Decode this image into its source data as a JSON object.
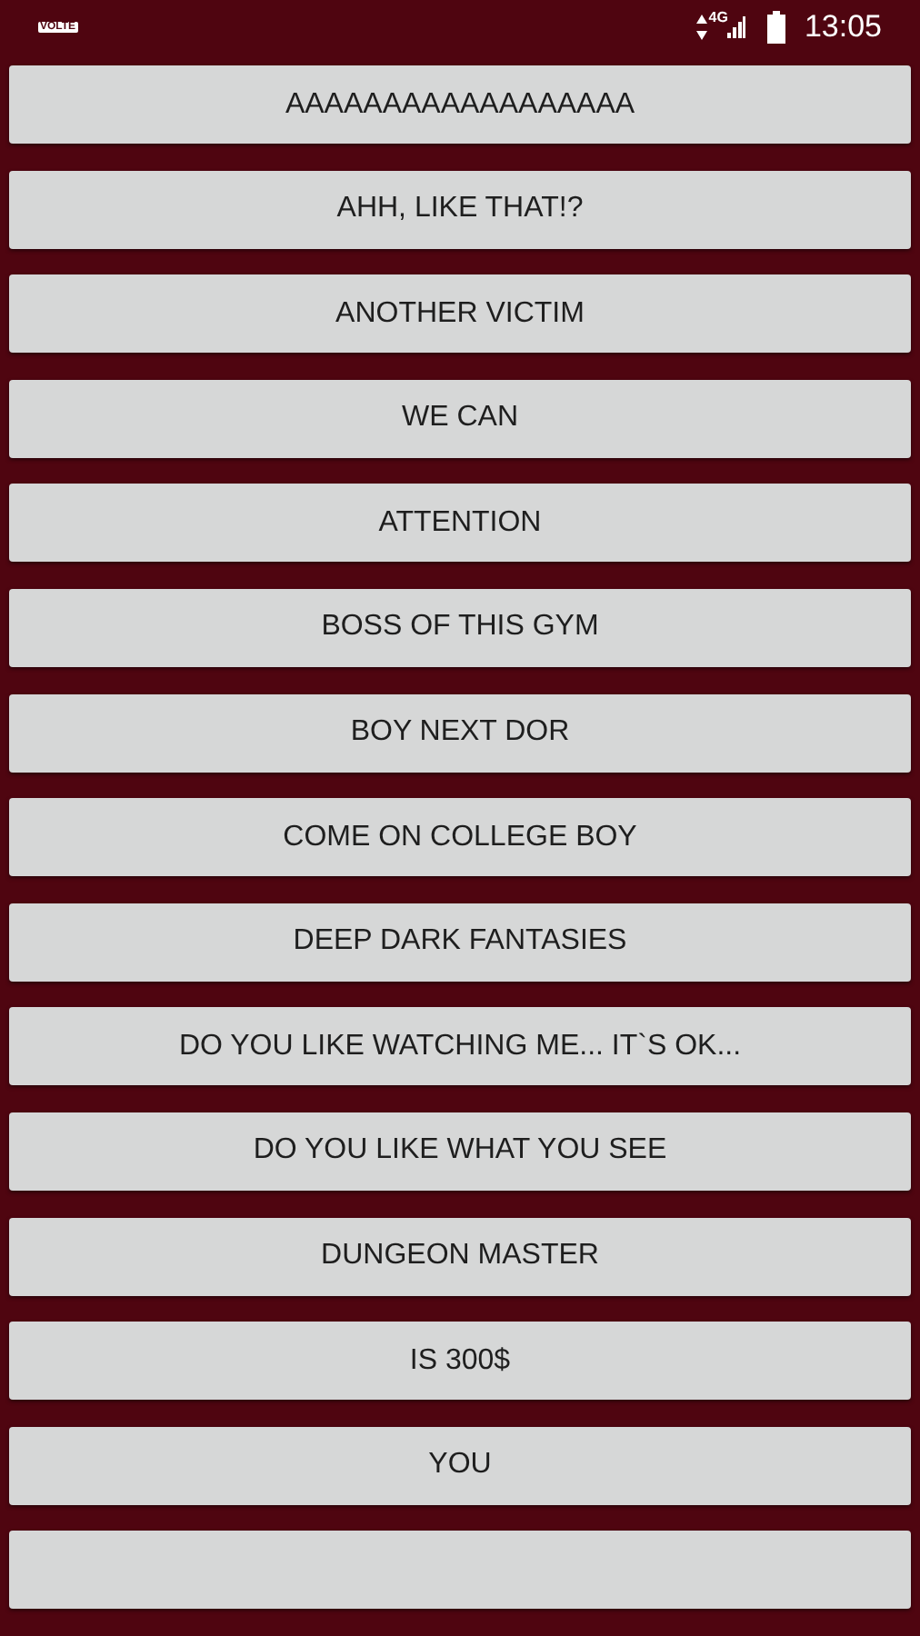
{
  "status_bar": {
    "volte": "VOLTE",
    "network": "4G",
    "time": "13:05"
  },
  "buttons": [
    {
      "kind": "sound",
      "label": "AAAAAAAAAAAAAAAAAA"
    },
    {
      "kind": "sound",
      "label": "AHH, LIKE THAT!?"
    },
    {
      "kind": "sound",
      "label": "ANOTHER VICTIM"
    },
    {
      "kind": "sound",
      "label": "WE CAN"
    },
    {
      "kind": "sound",
      "label": "ATTENTION"
    },
    {
      "kind": "sound",
      "label": "BOSS OF THIS GYM"
    },
    {
      "kind": "sound",
      "label": "BOY NEXT DOR"
    },
    {
      "kind": "sound",
      "label": "COME ON COLLEGE BOY"
    },
    {
      "kind": "sound",
      "label": "DEEP DARK FANTASIES"
    },
    {
      "kind": "sound",
      "label": "DO YOU LIKE WATCHING ME... IT`S OK..."
    },
    {
      "kind": "sound",
      "label": "DO YOU LIKE WHAT YOU SEE"
    },
    {
      "kind": "sound",
      "label": "DUNGEON MASTER"
    },
    {
      "kind": "sound",
      "label": "IS 300$"
    },
    {
      "kind": "sound",
      "label": "YOU"
    },
    {
      "kind": "empty"
    }
  ]
}
